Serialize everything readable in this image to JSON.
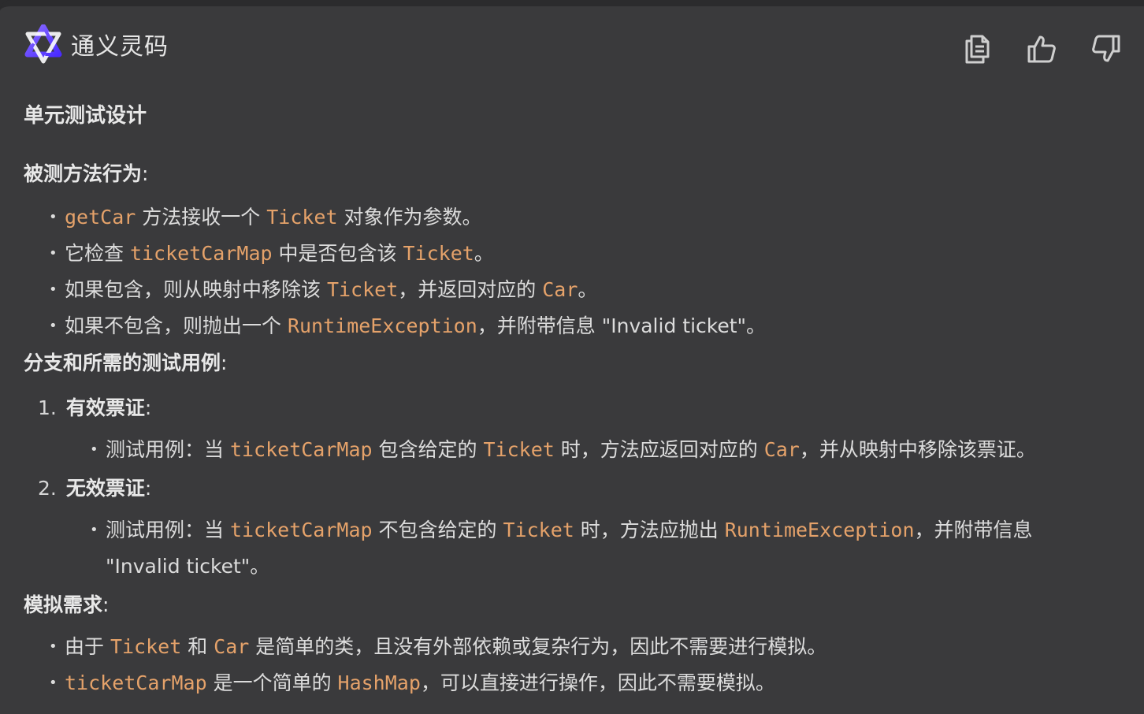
{
  "header": {
    "title": "通义灵码",
    "actions": {
      "copy_icon": "copy-icon",
      "like_icon": "thumbs-up-icon",
      "dislike_icon": "thumbs-down-icon"
    }
  },
  "content": {
    "title": "单元测试设计",
    "behavior": {
      "heading": "被测方法行为",
      "colon": ":",
      "items": [
        [
          {
            "c": "getCar"
          },
          {
            "t": " 方法接收一个 "
          },
          {
            "c": "Ticket"
          },
          {
            "t": " 对象作为参数。"
          }
        ],
        [
          {
            "t": "它检查 "
          },
          {
            "c": "ticketCarMap"
          },
          {
            "t": " 中是否包含该 "
          },
          {
            "c": "Ticket"
          },
          {
            "t": "。"
          }
        ],
        [
          {
            "t": "如果包含，则从映射中移除该 "
          },
          {
            "c": "Ticket"
          },
          {
            "t": "，并返回对应的 "
          },
          {
            "c": "Car"
          },
          {
            "t": "。"
          }
        ],
        [
          {
            "t": "如果不包含，则抛出一个 "
          },
          {
            "c": "RuntimeException"
          },
          {
            "t": "，并附带信息 \"Invalid ticket\"。"
          }
        ]
      ]
    },
    "branches": {
      "heading": "分支和所需的测试用例",
      "colon": ":",
      "cases": [
        {
          "num": "1.",
          "label": "有效票证",
          "colon": ":",
          "detail": [
            {
              "t": "测试用例：当 "
            },
            {
              "c": "ticketCarMap"
            },
            {
              "t": " 包含给定的 "
            },
            {
              "c": "Ticket"
            },
            {
              "t": " 时，方法应返回对应的 "
            },
            {
              "c": "Car"
            },
            {
              "t": "，并从映射中移除该票证。"
            }
          ]
        },
        {
          "num": "2.",
          "label": "无效票证",
          "colon": ":",
          "detail": [
            {
              "t": "测试用例：当 "
            },
            {
              "c": "ticketCarMap"
            },
            {
              "t": " 不包含给定的 "
            },
            {
              "c": "Ticket"
            },
            {
              "t": " 时，方法应抛出 "
            },
            {
              "c": "RuntimeException"
            },
            {
              "t": "，并附带信息 \"Invalid ticket\"。"
            }
          ]
        }
      ]
    },
    "mock": {
      "heading": "模拟需求",
      "colon": ":",
      "items": [
        [
          {
            "t": "由于 "
          },
          {
            "c": "Ticket"
          },
          {
            "t": " 和 "
          },
          {
            "c": "Car"
          },
          {
            "t": " 是简单的类，且没有外部依赖或复杂行为，因此不需要进行模拟。"
          }
        ],
        [
          {
            "c": "ticketCarMap"
          },
          {
            "t": " 是一个简单的 "
          },
          {
            "c": "HashMap"
          },
          {
            "t": "，可以直接进行操作，因此不需要模拟。"
          }
        ]
      ]
    }
  },
  "colors": {
    "background": "#3a3a3c",
    "code_accent": "#e5a26a",
    "text": "#dcdcdc",
    "logo_purple": "#6b4bff"
  }
}
